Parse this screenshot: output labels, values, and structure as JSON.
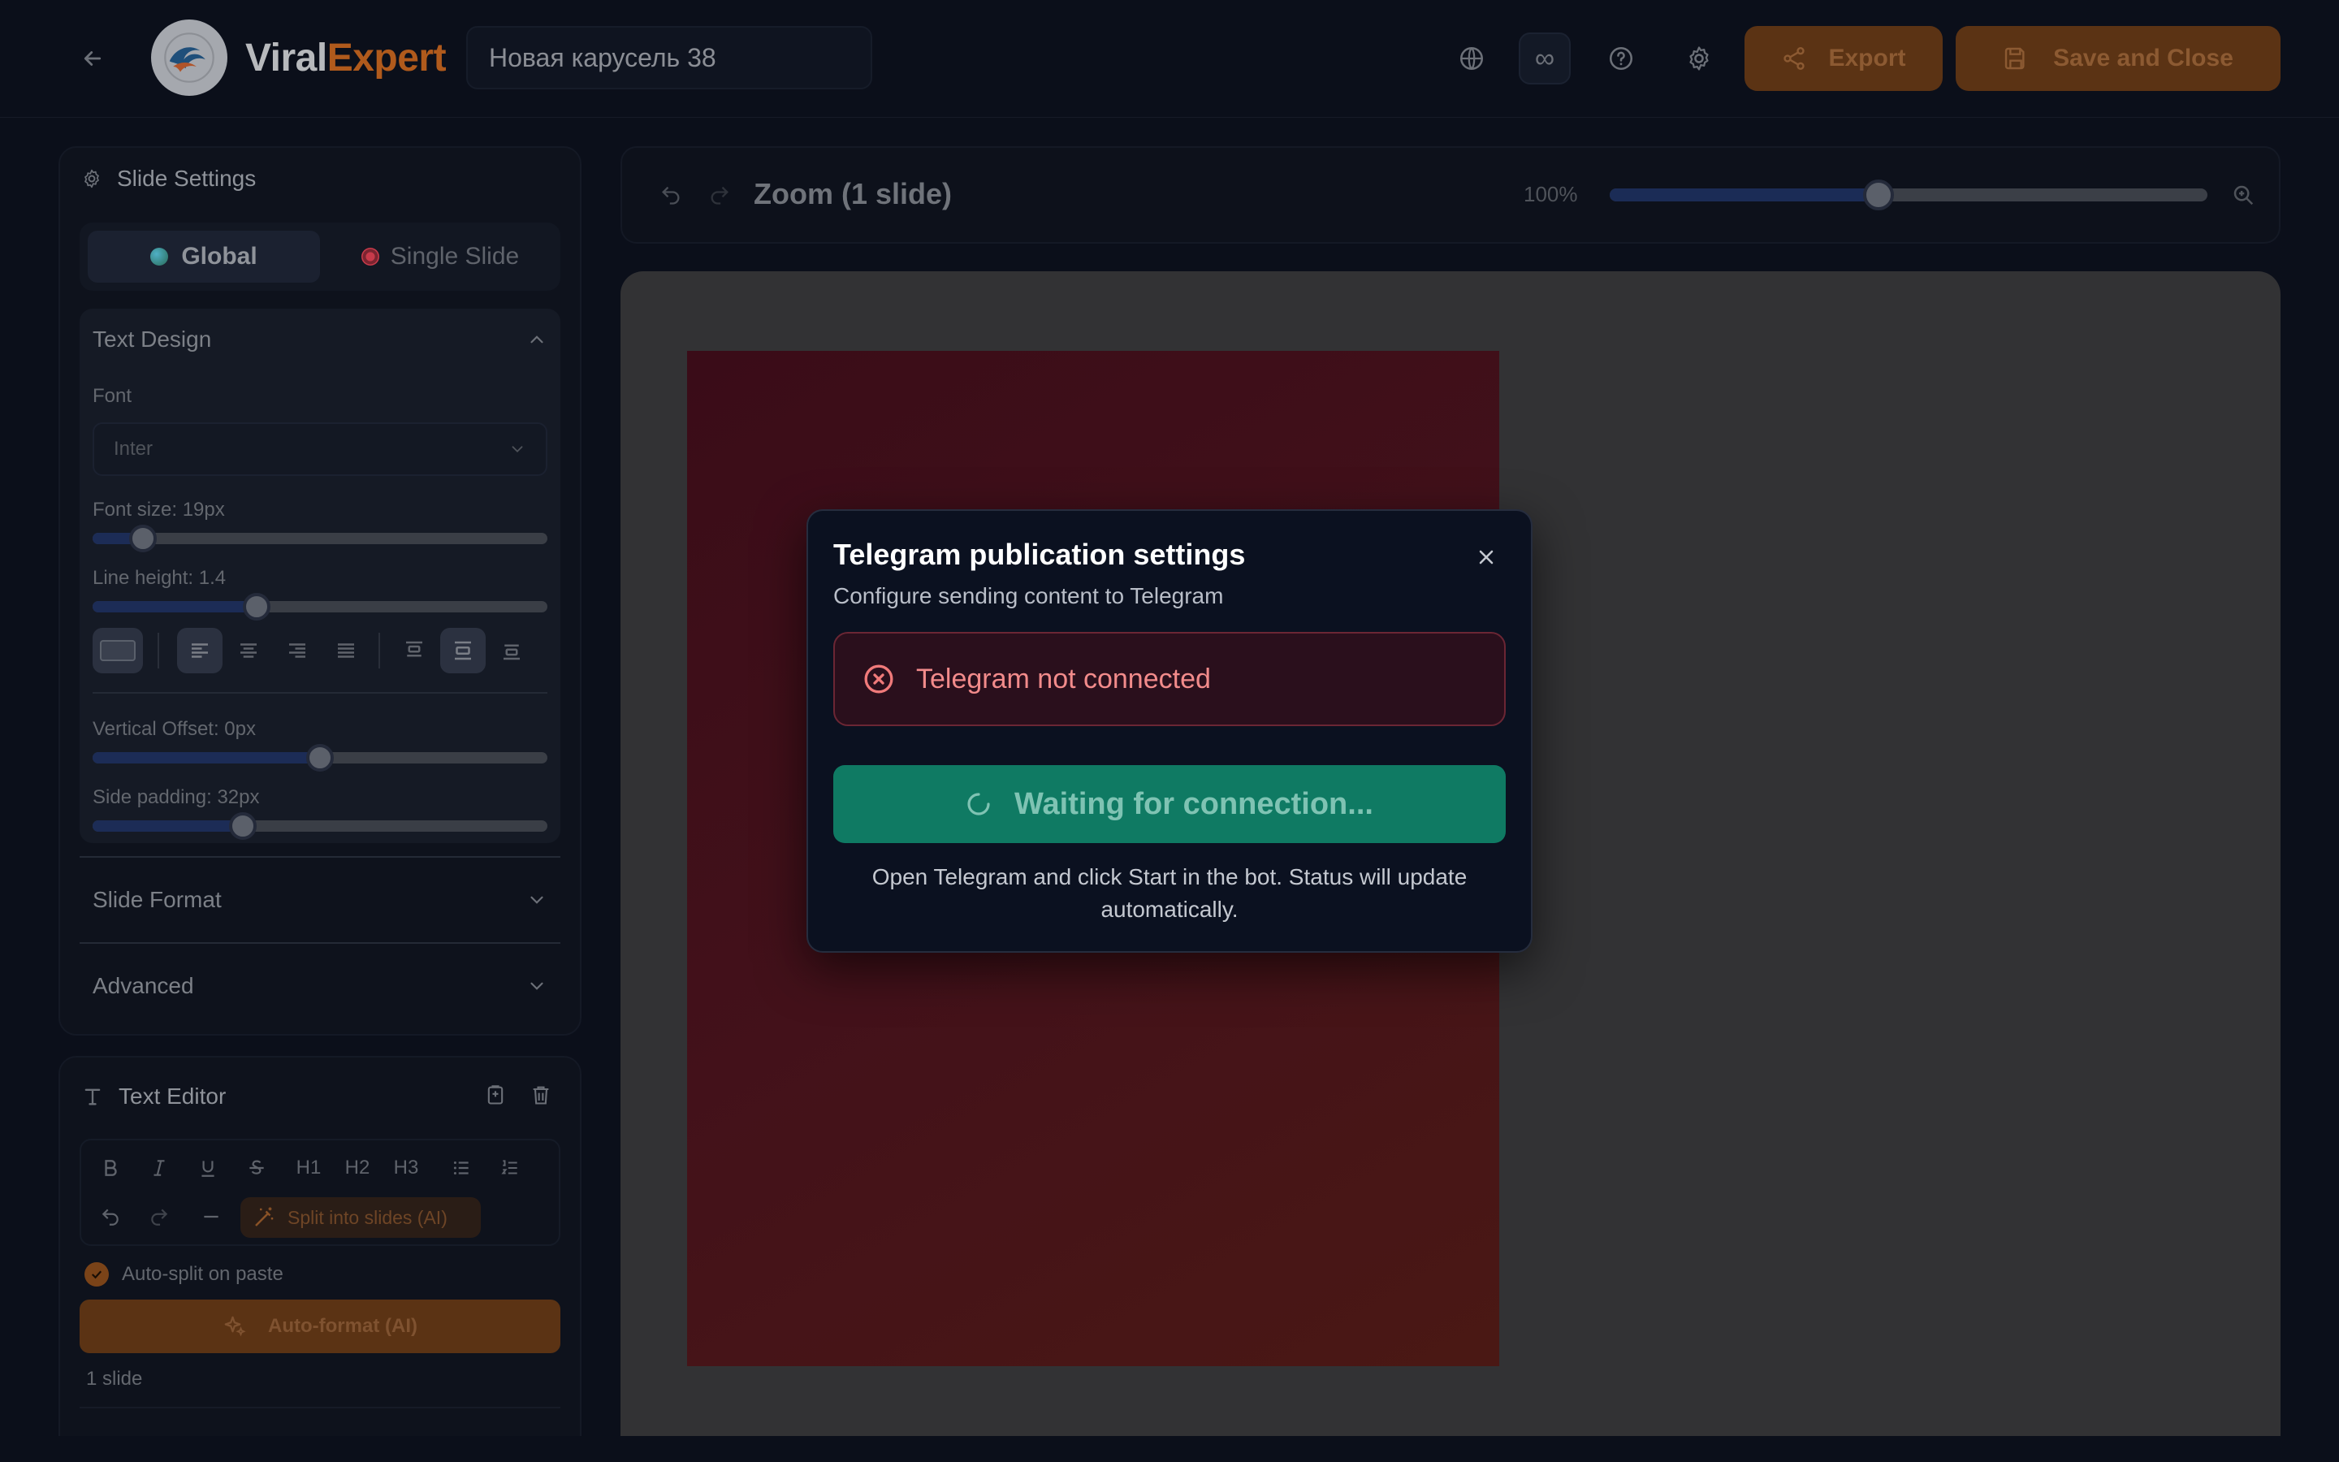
{
  "header": {
    "logo_part1": "Viral",
    "logo_part2": "Expert",
    "project_title": "Новая карусель 38",
    "export_label": "Export",
    "save_close_label": "Save and Close",
    "infinity_symbol": "∞"
  },
  "settings": {
    "panel_title": "Slide Settings",
    "scope_tabs": {
      "global": "Global",
      "single": "Single Slide"
    },
    "text_design": {
      "title": "Text Design",
      "font_label": "Font",
      "font_value": "Inter",
      "font_size_label": "Font size: 19px",
      "font_size_level": 0.11,
      "line_height_label": "Line height: 1.4",
      "line_height_level": 0.36,
      "vertical_offset_label": "Vertical Offset: 0px",
      "vertical_offset_level": 0.5,
      "side_padding_label": "Side padding: 32px",
      "side_padding_level": 0.33
    },
    "slide_format_title": "Slide Format",
    "advanced_title": "Advanced"
  },
  "editor": {
    "title": "Text Editor",
    "toolbar": {
      "h1": "H1",
      "h2": "H2",
      "h3": "H3"
    },
    "split_label": "Split into slides (AI)",
    "auto_split_label": "Auto-split on paste",
    "auto_format_label": "Auto-format (AI)",
    "slide_count": "1 slide"
  },
  "zoom": {
    "title": "Zoom (1 slide)",
    "percent": "100%",
    "level": 0.45
  },
  "modal": {
    "title": "Telegram publication settings",
    "subtitle": "Configure sending content to Telegram",
    "alert_text": "Telegram not connected",
    "button_label": "Waiting for connection...",
    "note": "Open Telegram and click Start in the bot. Status will update automatically."
  },
  "colors": {
    "accent_orange": "#b05a1c",
    "success_green": "#0f7a63",
    "error_red": "#f28b8b"
  }
}
